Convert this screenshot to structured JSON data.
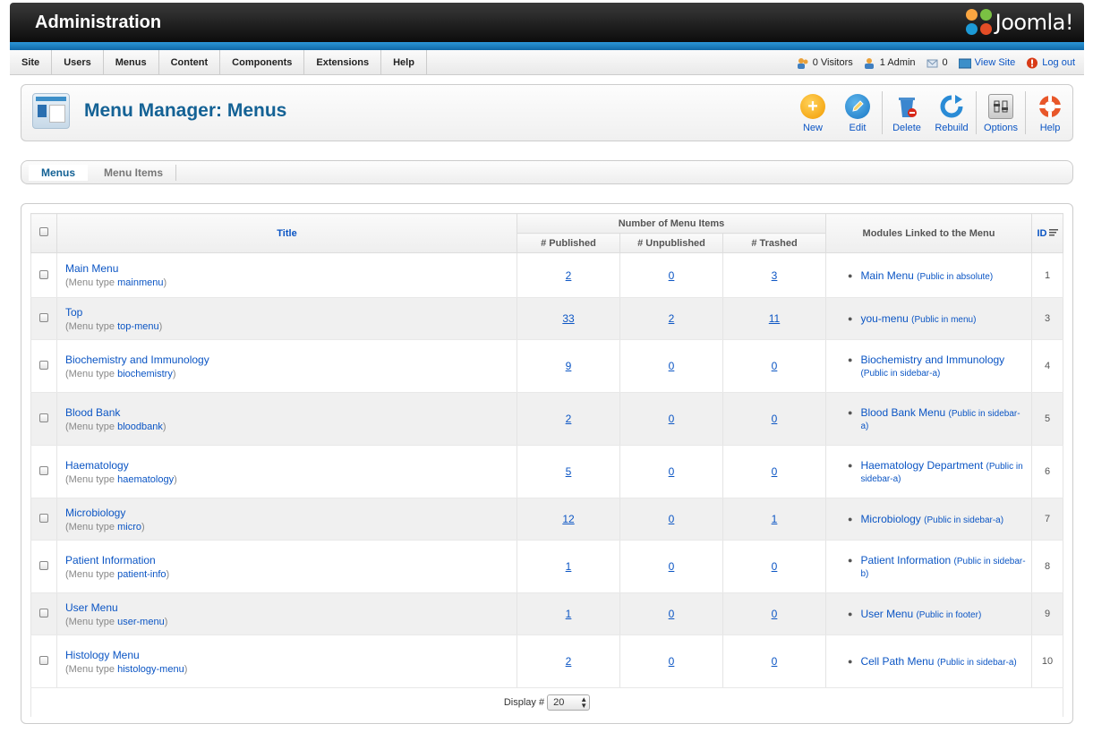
{
  "header": {
    "title": "Administration",
    "logo_text": "Joomla!"
  },
  "menubar": {
    "items": [
      "Site",
      "Users",
      "Menus",
      "Content",
      "Components",
      "Extensions",
      "Help"
    ],
    "visitors": "0 Visitors",
    "admins": "1 Admin",
    "messages": "0",
    "view_site": "View Site",
    "logout": "Log out"
  },
  "toolbar": {
    "title": "Menu Manager: Menus",
    "new": "New",
    "edit": "Edit",
    "delete": "Delete",
    "rebuild": "Rebuild",
    "options": "Options",
    "help": "Help"
  },
  "submenu": {
    "menus": "Menus",
    "menu_items": "Menu Items"
  },
  "table": {
    "h_title": "Title",
    "h_number": "Number of Menu Items",
    "h_published": "# Published",
    "h_unpublished": "# Unpublished",
    "h_trashed": "# Trashed",
    "h_modules": "Modules Linked to the Menu",
    "h_id": "ID",
    "menu_type_label": "Menu type",
    "rows": [
      {
        "title": "Main Menu",
        "type": "mainmenu",
        "published": "2",
        "unpublished": "0",
        "trashed": "3",
        "module": "Main Menu",
        "module_note": "(Public in absolute)",
        "id": "1"
      },
      {
        "title": "Top",
        "type": "top-menu",
        "published": "33",
        "unpublished": "2",
        "trashed": "11",
        "module": "you-menu",
        "module_note": "(Public in menu)",
        "id": "3"
      },
      {
        "title": "Biochemistry and Immunology",
        "type": "biochemistry",
        "published": "9",
        "unpublished": "0",
        "trashed": "0",
        "module": "Biochemistry and Immunology",
        "module_note": "(Public in sidebar-a)",
        "id": "4"
      },
      {
        "title": "Blood Bank",
        "type": "bloodbank",
        "published": "2",
        "unpublished": "0",
        "trashed": "0",
        "module": "Blood Bank Menu",
        "module_note": "(Public in sidebar-a)",
        "id": "5"
      },
      {
        "title": "Haematology",
        "type": "haematology",
        "published": "5",
        "unpublished": "0",
        "trashed": "0",
        "module": "Haematology Department",
        "module_note": "(Public in sidebar-a)",
        "id": "6"
      },
      {
        "title": "Microbiology",
        "type": "micro",
        "published": "12",
        "unpublished": "0",
        "trashed": "1",
        "module": "Microbiology",
        "module_note": "(Public in sidebar-a)",
        "id": "7"
      },
      {
        "title": "Patient Information",
        "type": "patient-info",
        "published": "1",
        "unpublished": "0",
        "trashed": "0",
        "module": "Patient Information",
        "module_note": "(Public in sidebar-b)",
        "id": "8"
      },
      {
        "title": "User Menu",
        "type": "user-menu",
        "published": "1",
        "unpublished": "0",
        "trashed": "0",
        "module": "User Menu",
        "module_note": "(Public in footer)",
        "id": "9"
      },
      {
        "title": "Histology Menu",
        "type": "histology-menu",
        "published": "2",
        "unpublished": "0",
        "trashed": "0",
        "module": "Cell Path Menu",
        "module_note": "(Public in sidebar-a)",
        "id": "10"
      }
    ],
    "display_label": "Display #",
    "display_value": "20"
  },
  "colors": {
    "header_dark": "#0c0c0c",
    "accent_blue": "#146295",
    "link": "#0b55c4",
    "bar_blue": "#2b96d7"
  },
  "icons": [
    "joomla-logo-icon",
    "users-icon",
    "admin-icon",
    "messages-icon",
    "view-site-icon",
    "logout-icon",
    "new-icon",
    "edit-icon",
    "delete-icon",
    "rebuild-icon",
    "options-icon",
    "help-icon",
    "sort-icon"
  ]
}
